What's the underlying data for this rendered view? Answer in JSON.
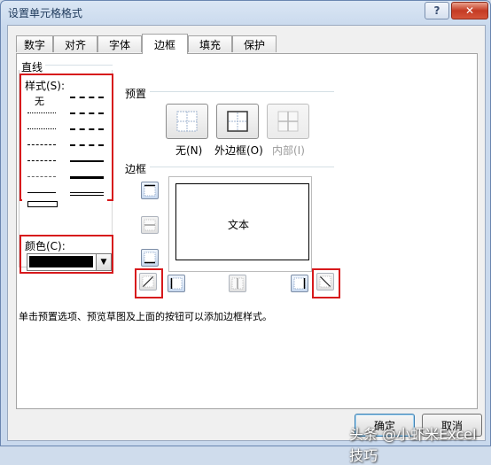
{
  "window": {
    "title": "设置单元格格式",
    "help_label": "?",
    "close_label": "✕"
  },
  "tabs": [
    {
      "label": "数字"
    },
    {
      "label": "对齐"
    },
    {
      "label": "字体"
    },
    {
      "label": "边框"
    },
    {
      "label": "填充"
    },
    {
      "label": "保护"
    }
  ],
  "active_tab": "边框",
  "line_section": {
    "title": "直线",
    "style_label": "样式(S):",
    "none_label": "无",
    "color_label": "颜色(C):",
    "selected_color": "#000000"
  },
  "presets": {
    "title": "预置",
    "none": "无(N)",
    "outline": "外边框(O)",
    "inside": "内部(I)"
  },
  "border_section": {
    "title": "边框",
    "preview_text": "文本"
  },
  "hint_text": "单击预置选项、预览草图及上面的按钮可以添加边框样式。",
  "buttons": {
    "ok": "确定",
    "cancel": "取消"
  },
  "watermark": "头条 @小虾米Excel技巧",
  "colors": {
    "highlight": "#d7191c",
    "title_text": "#1e395b"
  }
}
